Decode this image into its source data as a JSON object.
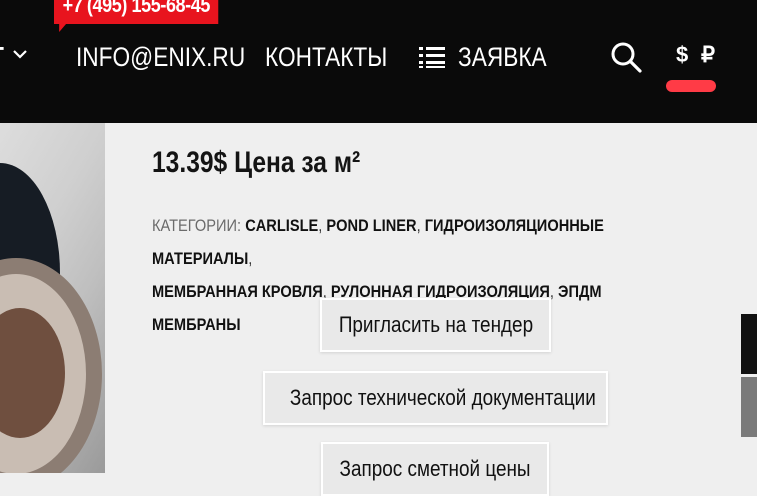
{
  "header": {
    "phone": "+7 (495) 155-68-45",
    "left_cut_text": "Т",
    "nav": {
      "email": "INFO@ENIX.RU",
      "contacts": "КОНТАКТЫ",
      "request": "ЗАЯВКА"
    },
    "currency": {
      "usd": "$",
      "rub": "₽",
      "active": "$"
    },
    "accent_color": "#ff3b46",
    "phone_bg_color": "#e8141e"
  },
  "product": {
    "price": "13.39$ Цена за м²",
    "categories_label": "КАТЕГОРИИ:",
    "categories": [
      "CARLISLE",
      "POND LINER",
      "ГИДРОИЗОЛЯЦИОННЫЕ МАТЕРИАЛЫ",
      "МЕМБРАННАЯ КРОВЛЯ",
      "РУЛОННАЯ ГИДРОИЗОЛЯЦИЯ",
      "ЭПДМ МЕМБРАНЫ"
    ],
    "separator": ",",
    "buttons": {
      "tender": "Пригласить на тендер",
      "tech_docs": "Запрос технической документации",
      "estimate": "Запрос сметной цены"
    }
  }
}
